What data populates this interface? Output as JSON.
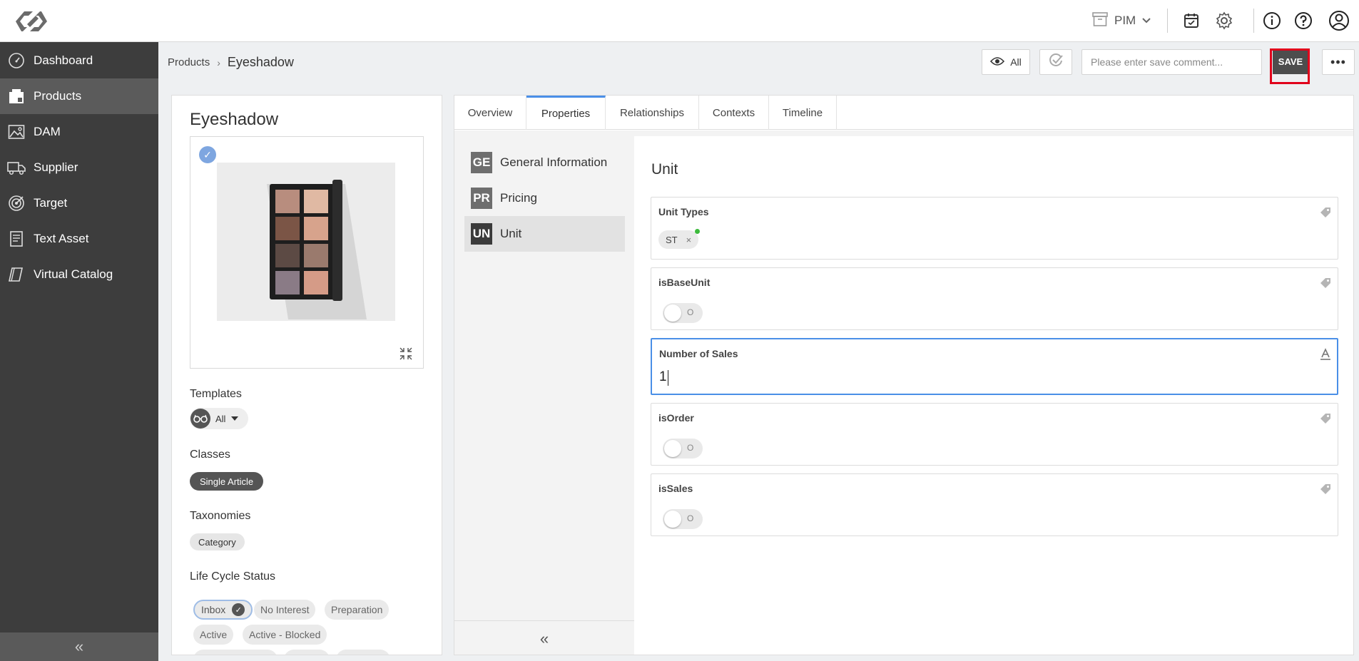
{
  "topbar": {
    "module_label": "PIM",
    "icons": [
      "calendar-icon",
      "gear-icon",
      "info-icon",
      "help-icon",
      "user-icon"
    ]
  },
  "sidebar": {
    "items": [
      {
        "label": "Dashboard",
        "icon": "dashboard-icon"
      },
      {
        "label": "Products",
        "icon": "products-icon",
        "active": true
      },
      {
        "label": "DAM",
        "icon": "image-icon"
      },
      {
        "label": "Supplier",
        "icon": "truck-icon"
      },
      {
        "label": "Target",
        "icon": "target-icon"
      },
      {
        "label": "Text Asset",
        "icon": "document-icon"
      },
      {
        "label": "Virtual Catalog",
        "icon": "catalog-icon"
      }
    ],
    "collapse_glyph": "«"
  },
  "header": {
    "breadcrumb_parent": "Products",
    "breadcrumb_separator": "›",
    "breadcrumb_current": "Eyeshadow",
    "view_label": "All",
    "comment_placeholder": "Please enter save comment...",
    "save_label": "SAVE",
    "more_label": "•••"
  },
  "product": {
    "title": "Eyeshadow",
    "templates_label": "Templates",
    "template_value": "All",
    "classes_label": "Classes",
    "class_value": "Single Article",
    "taxonomies_label": "Taxonomies",
    "taxonomy_value": "Category",
    "lifecycle_label": "Life Cycle Status",
    "lifecycle_statuses": [
      {
        "label": "Inbox",
        "selected": true
      },
      {
        "label": "No Interest",
        "selected": false
      },
      {
        "label": "Preparation",
        "selected": false
      },
      {
        "label": "Active",
        "selected": false
      },
      {
        "label": "Active - Blocked",
        "selected": false
      }
    ]
  },
  "tabs": [
    {
      "label": "Overview",
      "active": false
    },
    {
      "label": "Properties",
      "active": true
    },
    {
      "label": "Relationships",
      "active": false
    },
    {
      "label": "Contexts",
      "active": false
    },
    {
      "label": "Timeline",
      "active": false
    }
  ],
  "groups": [
    {
      "abbr": "GE",
      "label": "General Information",
      "active": false
    },
    {
      "abbr": "PR",
      "label": "Pricing",
      "active": false
    },
    {
      "abbr": "UN",
      "label": "Unit",
      "active": true
    }
  ],
  "group_collapse_glyph": "«",
  "content": {
    "title": "Unit",
    "fields": {
      "unit_types": {
        "label": "Unit Types",
        "chip": "ST",
        "chip_remove": "×"
      },
      "is_base_unit": {
        "label": "isBaseUnit",
        "toggle_text": "O",
        "on": false
      },
      "number_of_sales": {
        "label": "Number of Sales",
        "value": "1"
      },
      "is_order": {
        "label": "isOrder",
        "toggle_text": "O",
        "on": false
      },
      "is_sales": {
        "label": "isSales",
        "toggle_text": "O",
        "on": false
      }
    }
  },
  "colors": {
    "sidebar_bg": "#3d3d3d",
    "sidebar_active": "#5b5b5b",
    "accent_blue": "#4a8fe7",
    "save_bg": "#4d4d4d",
    "highlight_red": "#e0001b"
  }
}
